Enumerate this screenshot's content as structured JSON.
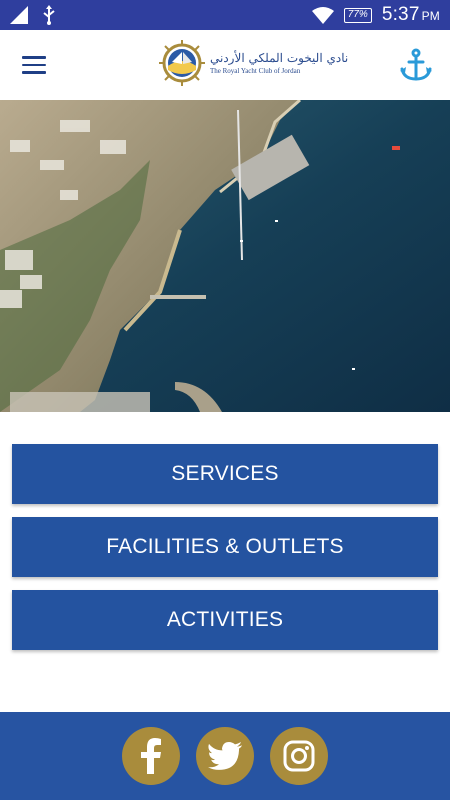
{
  "status_bar": {
    "battery": "77%",
    "time": "5:37",
    "ampm": "PM",
    "icons": [
      "signal-icon",
      "usb-icon",
      "wifi-icon",
      "battery-icon"
    ]
  },
  "app_bar": {
    "logo_arabic": "نادي اليخوت الملكي الأردني",
    "logo_english": "The Royal Yacht Club of Jordan",
    "icons": [
      "hamburger-menu-icon",
      "anchor-icon"
    ]
  },
  "menu": {
    "items": [
      {
        "label": "SERVICES"
      },
      {
        "label": "FACILITIES & OUTLETS"
      },
      {
        "label": "ACTIVITIES"
      }
    ]
  },
  "footer": {
    "social": [
      "facebook-icon",
      "twitter-icon",
      "instagram-icon"
    ],
    "accent": "#a98c3c"
  },
  "colors": {
    "status_bar": "#2f3e9e",
    "primary": "#2453a0",
    "footer": "#2754a2"
  }
}
